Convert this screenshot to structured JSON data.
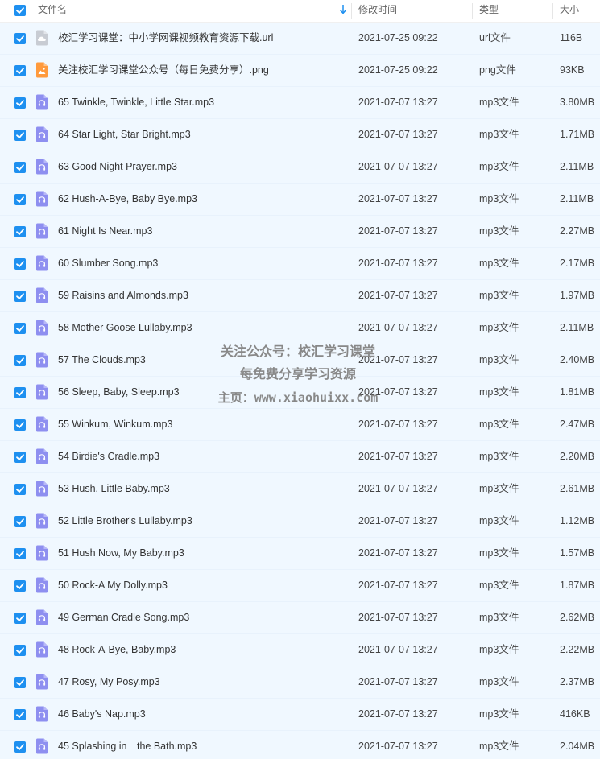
{
  "header": {
    "name_label": "文件名",
    "time_label": "修改时间",
    "type_label": "类型",
    "size_label": "大小"
  },
  "colors": {
    "accent": "#1e90f0",
    "row_selected_bg": "#f0f8ff",
    "audio_icon": "#8e8ff0",
    "image_icon": "#ff9a3c",
    "url_icon": "#c8ccd3"
  },
  "files": [
    {
      "name": "校汇学习课堂：中小学网课视频教育资源下载.url",
      "time": "2021-07-25 09:22",
      "type": "url文件",
      "size": "116B",
      "icon": "cloud-link-icon"
    },
    {
      "name": "关注校汇学习课堂公众号（每日免费分享）.png",
      "time": "2021-07-25 09:22",
      "type": "png文件",
      "size": "93KB",
      "icon": "image-file-icon"
    },
    {
      "name": "65 Twinkle, Twinkle, Little Star.mp3",
      "time": "2021-07-07 13:27",
      "type": "mp3文件",
      "size": "3.80MB",
      "icon": "audio-file-icon"
    },
    {
      "name": "64 Star Light, Star Bright.mp3",
      "time": "2021-07-07 13:27",
      "type": "mp3文件",
      "size": "1.71MB",
      "icon": "audio-file-icon"
    },
    {
      "name": "63 Good Night Prayer.mp3",
      "time": "2021-07-07 13:27",
      "type": "mp3文件",
      "size": "2.11MB",
      "icon": "audio-file-icon"
    },
    {
      "name": "62 Hush-A-Bye, Baby Bye.mp3",
      "time": "2021-07-07 13:27",
      "type": "mp3文件",
      "size": "2.11MB",
      "icon": "audio-file-icon"
    },
    {
      "name": "61 Night Is Near.mp3",
      "time": "2021-07-07 13:27",
      "type": "mp3文件",
      "size": "2.27MB",
      "icon": "audio-file-icon"
    },
    {
      "name": "60 Slumber Song.mp3",
      "time": "2021-07-07 13:27",
      "type": "mp3文件",
      "size": "2.17MB",
      "icon": "audio-file-icon"
    },
    {
      "name": "59 Raisins and Almonds.mp3",
      "time": "2021-07-07 13:27",
      "type": "mp3文件",
      "size": "1.97MB",
      "icon": "audio-file-icon"
    },
    {
      "name": "58 Mother Goose Lullaby.mp3",
      "time": "2021-07-07 13:27",
      "type": "mp3文件",
      "size": "2.11MB",
      "icon": "audio-file-icon"
    },
    {
      "name": "57 The Clouds.mp3",
      "time": "2021-07-07 13:27",
      "type": "mp3文件",
      "size": "2.40MB",
      "icon": "audio-file-icon"
    },
    {
      "name": "56 Sleep, Baby, Sleep.mp3",
      "time": "2021-07-07 13:27",
      "type": "mp3文件",
      "size": "1.81MB",
      "icon": "audio-file-icon"
    },
    {
      "name": "55 Winkum, Winkum.mp3",
      "time": "2021-07-07 13:27",
      "type": "mp3文件",
      "size": "2.47MB",
      "icon": "audio-file-icon"
    },
    {
      "name": "54 Birdie's Cradle.mp3",
      "time": "2021-07-07 13:27",
      "type": "mp3文件",
      "size": "2.20MB",
      "icon": "audio-file-icon"
    },
    {
      "name": "53 Hush, Little Baby.mp3",
      "time": "2021-07-07 13:27",
      "type": "mp3文件",
      "size": "2.61MB",
      "icon": "audio-file-icon"
    },
    {
      "name": "52 Little Brother's Lullaby.mp3",
      "time": "2021-07-07 13:27",
      "type": "mp3文件",
      "size": "1.12MB",
      "icon": "audio-file-icon"
    },
    {
      "name": "51 Hush Now, My Baby.mp3",
      "time": "2021-07-07 13:27",
      "type": "mp3文件",
      "size": "1.57MB",
      "icon": "audio-file-icon"
    },
    {
      "name": "50 Rock-A My Dolly.mp3",
      "time": "2021-07-07 13:27",
      "type": "mp3文件",
      "size": "1.87MB",
      "icon": "audio-file-icon"
    },
    {
      "name": "49 German Cradle Song.mp3",
      "time": "2021-07-07 13:27",
      "type": "mp3文件",
      "size": "2.62MB",
      "icon": "audio-file-icon"
    },
    {
      "name": "48 Rock-A-Bye, Baby.mp3",
      "time": "2021-07-07 13:27",
      "type": "mp3文件",
      "size": "2.22MB",
      "icon": "audio-file-icon"
    },
    {
      "name": "47 Rosy, My Posy.mp3",
      "time": "2021-07-07 13:27",
      "type": "mp3文件",
      "size": "2.37MB",
      "icon": "audio-file-icon"
    },
    {
      "name": "46 Baby's Nap.mp3",
      "time": "2021-07-07 13:27",
      "type": "mp3文件",
      "size": "416KB",
      "icon": "audio-file-icon"
    },
    {
      "name": "45 Splashing in　the Bath.mp3",
      "time": "2021-07-07 13:27",
      "type": "mp3文件",
      "size": "2.04MB",
      "icon": "audio-file-icon"
    }
  ],
  "watermark": {
    "line1": "关注公众号：校汇学习课堂",
    "line2": "每免费分享学习资源",
    "line3": "主页：www.xiaohuixx.com"
  }
}
